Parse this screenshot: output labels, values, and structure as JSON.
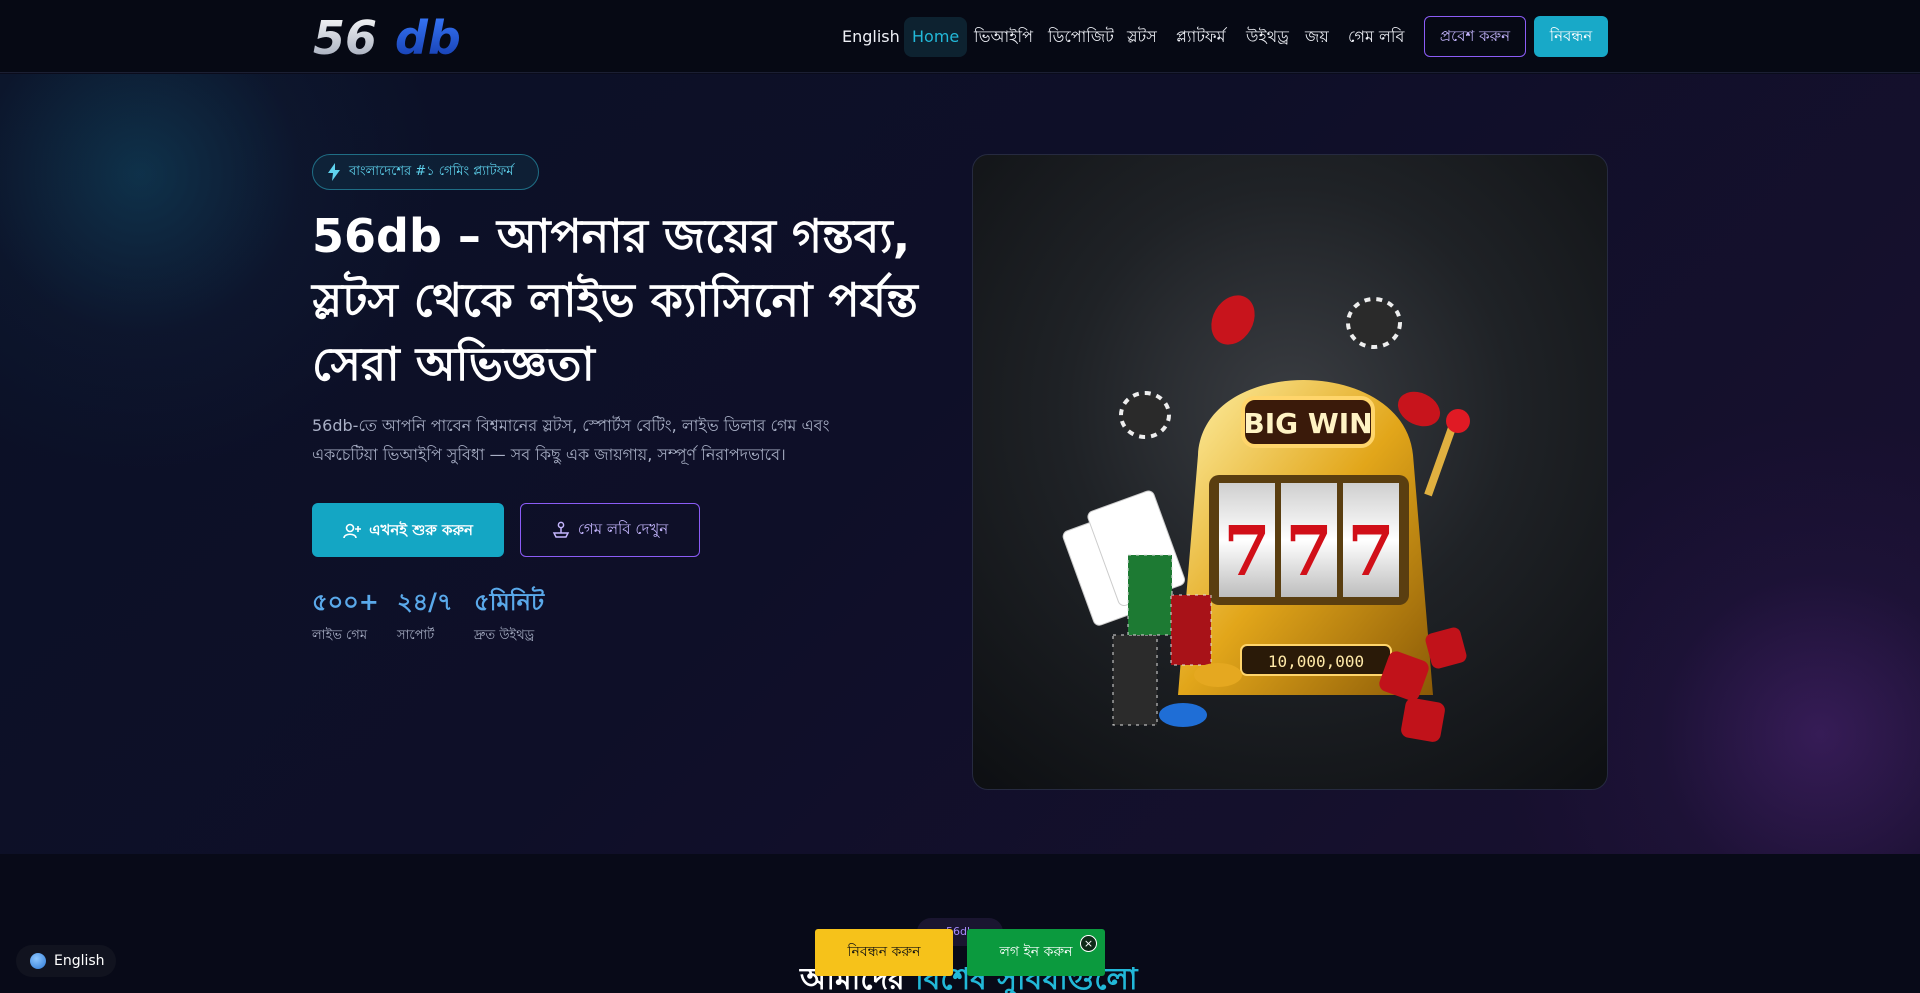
{
  "header": {
    "logo_text": "56db",
    "nav": [
      "English",
      "Home",
      "ভিআইপি",
      "ডিপোজিট",
      "স্লটস",
      "প্ল্যাটফর্ম",
      "উইথড্র",
      "জয়",
      "গেম লবি"
    ],
    "login_label": "প্রবেশ করুন",
    "register_label": "নিবন্ধন"
  },
  "hero": {
    "badge": "বাংলাদেশের #১ গেমিং প্ল্যাটফর্ম",
    "title_lines": [
      "56db – আপনার জয়ের গন্তব্য,",
      "স্লটস থেকে লাইভ ক্যাসিনো পর্যন্ত",
      "সেরা অভিজ্ঞতা"
    ],
    "description_lines": [
      "56db-তে আপনি পাবেন বিশ্বমানের স্লটস, স্পোর্টস বেটিং, লাইভ ডিলার গেম এবং",
      "একচেটিয়া ভিআইপি সুবিধা — সব কিছু এক জায়গায়, সম্পূর্ণ নিরাপদভাবে।"
    ],
    "cta_primary": "এখনই শুরু করুন",
    "cta_secondary": "গেম লবি দেখুন",
    "stats": [
      {
        "value": "৫০০+",
        "label": "লাইভ গেম"
      },
      {
        "value": "২৪/৭",
        "label": "সাপোর্ট"
      },
      {
        "value": "৫মিনিট",
        "label": "দ্রুত উইথড্র"
      }
    ],
    "image": {
      "sign": "BIG WIN",
      "reels": [
        "7",
        "7",
        "7"
      ],
      "counter": "10,000,000"
    }
  },
  "section2": {
    "pill": "56db",
    "title_part1": "আমাদের",
    "title_part2": "বিশেষ সুবিধাগুলো"
  },
  "floating": {
    "language": "English",
    "register": "নিবন্ধন করুন",
    "login": "লগ ইন করুন",
    "close": "×"
  },
  "colors": {
    "accent_cyan": "#18a9c8",
    "accent_purple": "#8b5cf6",
    "bg": "#0a0c1c",
    "cta_yellow": "#f6c21a",
    "cta_green": "#0b9a3e"
  }
}
